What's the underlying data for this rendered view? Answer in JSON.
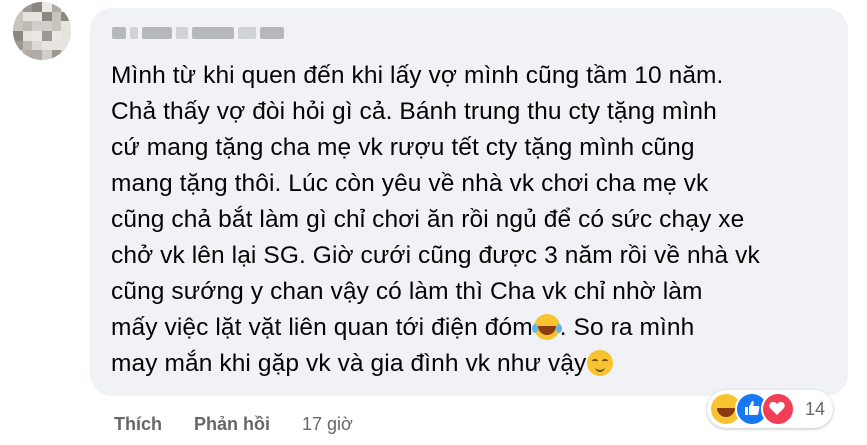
{
  "comment": {
    "text_lines": [
      "Mình từ khi quen đến khi lấy vợ mình cũng tầm 10 năm.",
      "Chả thấy vợ đòi hỏi gì cả. Bánh trung thu cty tặng mình",
      "cứ mang tặng cha mẹ vk rượu tết cty tặng mình cũng",
      "mang tặng thôi. Lúc còn yêu về nhà vk chơi cha mẹ vk",
      "cũng chả bắt làm gì chỉ chơi ăn rồi ngủ để có sức chạy xe",
      "chở vk lên lại SG. Giờ cưới cũng được 3 năm rồi về nhà vk",
      "cũng sướng y chan vậy có làm thì Cha vk chỉ nhờ làm",
      "mấy việc lặt vặt liên quan tới điện đóm",
      ". So ra mình",
      "may mắn khi gặp vk và gia đình vk như vậy"
    ],
    "emoji_1": "laughing-crying-emoji",
    "emoji_2": "relieved-face-emoji"
  },
  "actions": {
    "like_label": "Thích",
    "reply_label": "Phản hồi",
    "time": "17 giờ"
  },
  "reactions": {
    "types": [
      "haha",
      "like",
      "love"
    ],
    "count": "14"
  },
  "colors": {
    "bubble": "#f0f2f5",
    "meta_text": "#65676b",
    "like_blue": "#1877f2",
    "love_red": "#f33e58",
    "haha_yellow": "#f7c331"
  }
}
